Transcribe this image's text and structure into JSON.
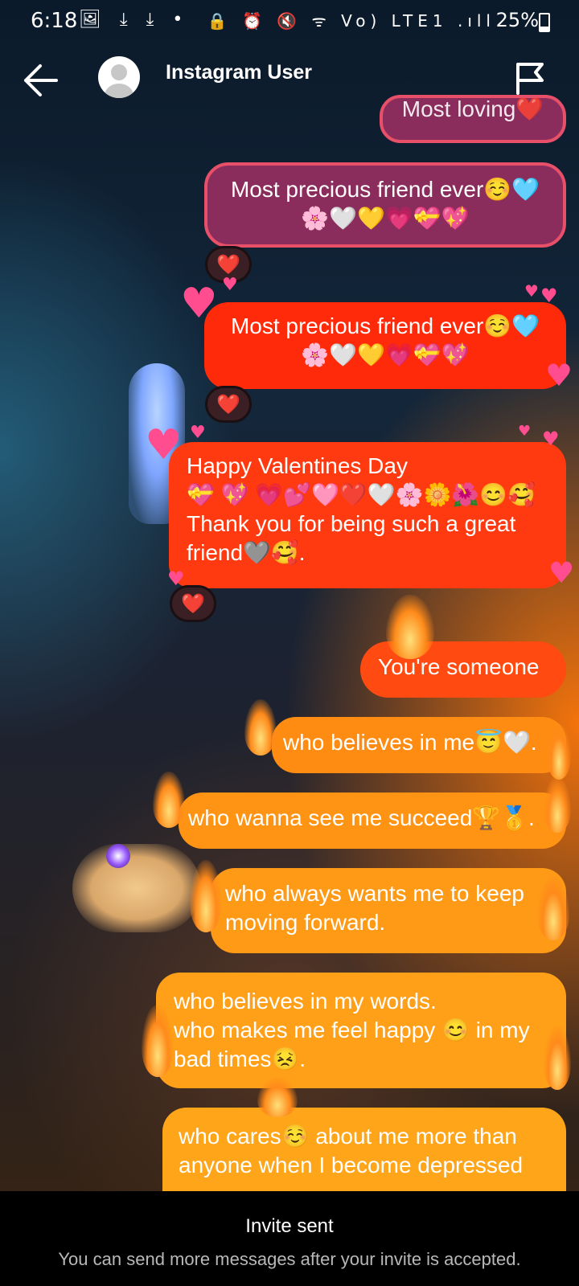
{
  "status_bar": {
    "time": "6:18",
    "left_icons": "🖼 ⤓ ⤓ •",
    "right_icons": "🔒 ⏰ 🔇 ᯤ Vo) LTE1 .ıll",
    "battery": "25%"
  },
  "header": {
    "contact_name": "Instagram User",
    "back_icon": "back-arrow-icon",
    "flag_icon": "flag-icon"
  },
  "messages": [
    {
      "lines": [
        "Most loving❤️"
      ]
    },
    {
      "lines": [
        "Most precious friend ever☺️🩵",
        "🌸🤍💛💗💝💖"
      ]
    },
    {
      "lines": [
        "Most precious friend ever☺️🩵",
        "🌸🤍💛💗💝💖"
      ]
    },
    {
      "lines": [
        "Happy Valentines Day",
        "💝 💖 💗💕🩷❤️🤍🌸🌼🌺😊🥰",
        "Thank you for being such a great",
        "friend🩶🥰."
      ]
    },
    {
      "lines": [
        "You're someone"
      ]
    },
    {
      "lines": [
        "who believes in me😇🤍."
      ]
    },
    {
      "lines": [
        "who wanna see me succeed🏆🥇."
      ]
    },
    {
      "lines": [
        "who always wants me to keep",
        "moving forward."
      ]
    },
    {
      "lines": [
        "who believes in my words.",
        "who makes me feel happy 😊 in my",
        "bad times😣."
      ]
    },
    {
      "lines": [
        "who cares☺️ about me more than",
        "anyone when I become depressed"
      ]
    }
  ],
  "reactions": [
    "❤️",
    "❤️",
    "❤️"
  ],
  "footer": {
    "title": "Invite sent",
    "subtitle": "You can send more messages after your invite is accepted."
  },
  "colors": {
    "accent_red": "#ff2a0a",
    "accent_orange": "#ffa018",
    "bubble_purple": "#8b2d5c"
  }
}
